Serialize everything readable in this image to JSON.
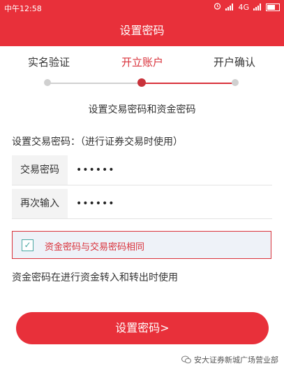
{
  "statusbar": {
    "time": "中午12:58",
    "network": "4G"
  },
  "header": {
    "title": "设置密码"
  },
  "steps": [
    {
      "label": "实名验证",
      "active": false
    },
    {
      "label": "开立账户",
      "active": true
    },
    {
      "label": "开户确认",
      "active": false
    }
  ],
  "main": {
    "subtitle": "设置交易密码和资金密码",
    "section_label": "设置交易密码：（进行证券交易时使用）",
    "fields": [
      {
        "label": "交易密码",
        "value": "••••••"
      },
      {
        "label": "再次输入",
        "value": "••••••"
      }
    ],
    "checkbox": {
      "label": "资金密码与交易密码相同",
      "checked": true,
      "mark": "✓"
    },
    "note": "资金密码在进行资金转入和转出时使用",
    "submit_label": "设置密码>"
  },
  "watermark": {
    "text": "安大证券新城广场营业部"
  },
  "colors": {
    "accent": "#e8303a",
    "check": "#4aa8a3"
  }
}
